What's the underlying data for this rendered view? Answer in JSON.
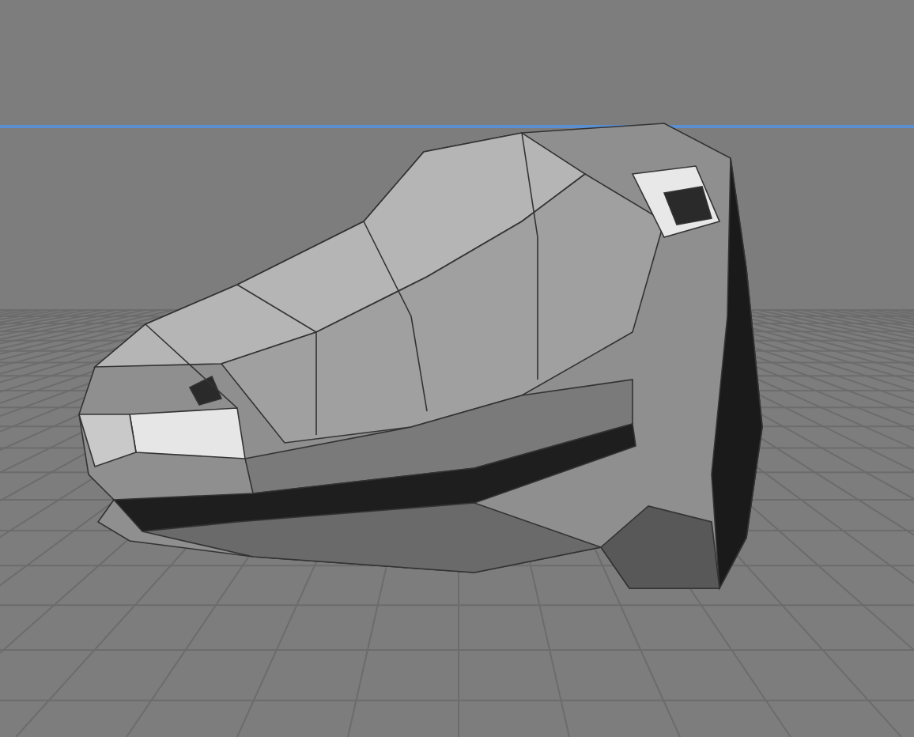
{
  "viewport": {
    "grid_visible": true,
    "horizon_visible": true
  }
}
